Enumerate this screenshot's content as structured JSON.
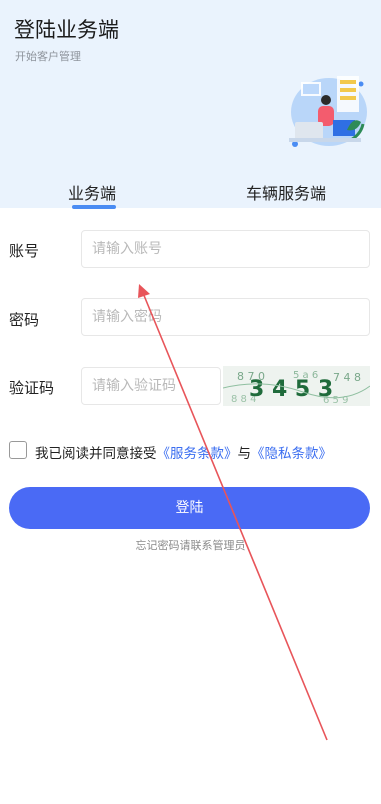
{
  "header": {
    "title": "登陆业务端",
    "subtitle": "开始客户管理"
  },
  "tabs": [
    {
      "label": "业务端",
      "active": true
    },
    {
      "label": "车辆服务端",
      "active": false
    }
  ],
  "form": {
    "account": {
      "label": "账号",
      "placeholder": "请输入账号",
      "value": ""
    },
    "password": {
      "label": "密码",
      "placeholder": "请输入密码",
      "value": ""
    },
    "captcha": {
      "label": "验证码",
      "placeholder": "请输入验证码",
      "value": "",
      "image_text": "3 4 5 3"
    }
  },
  "agreement": {
    "checked": false,
    "prefix": "我已阅读并同意接受",
    "service_link": "《服务条款》",
    "connector": "与",
    "privacy_link": "《隐私条款》"
  },
  "login_button": "登陆",
  "forgot_text": "忘记密码请联系管理员",
  "colors": {
    "header_bg": "#eaf3fd",
    "tab_indicator": "#4a8cf3",
    "primary": "#4a6af5",
    "link": "#3a6df0",
    "annotation_arrow": "#e8555a"
  }
}
